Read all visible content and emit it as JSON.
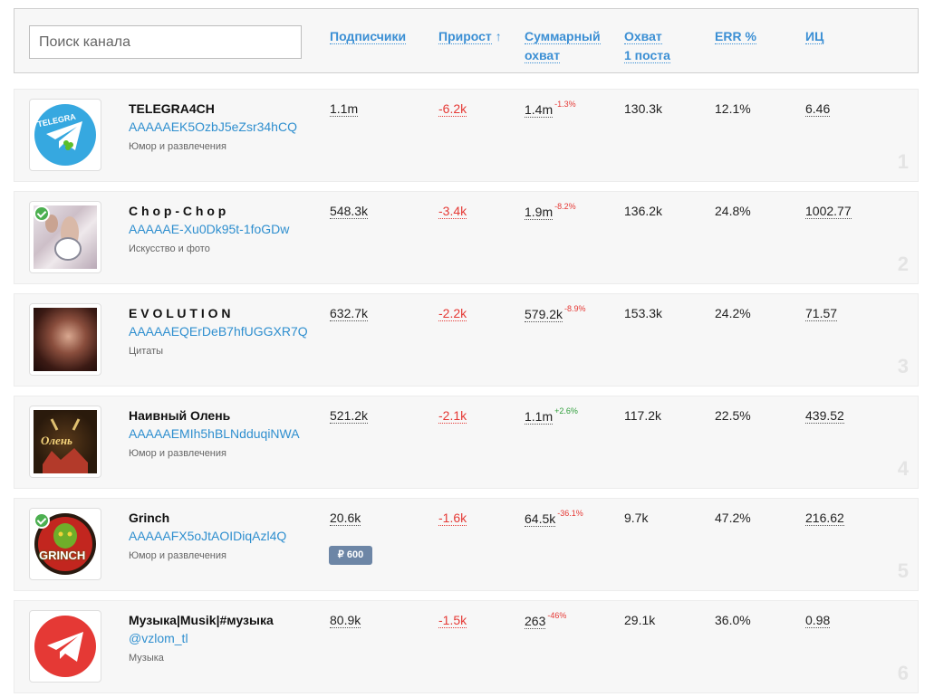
{
  "search": {
    "placeholder": "Поиск канала"
  },
  "columns": {
    "subscribers": "Подписчики",
    "growth": "Прирост",
    "growth_arrow": "↑",
    "reach_line1": "Суммарный",
    "reach_line2": "охват",
    "post_reach_line1": "Охват",
    "post_reach_line2": "1 поста",
    "err": "ERR %",
    "ic": "ИЦ"
  },
  "channels": [
    {
      "rank": "1",
      "name": "TELEGRA4CH",
      "link": "AAAAAEK5OzbJ5eZsr34hCQ",
      "category": "Юмор и развлечения",
      "subscribers": "1.1m",
      "growth": "-6.2k",
      "reach": "1.4m",
      "reach_change": "-1.3%",
      "post_reach": "130.3k",
      "err": "12.1%",
      "ic": "6.46",
      "verified": false,
      "avatar_text": "TELEGRA"
    },
    {
      "rank": "2",
      "name": "C h o p - C h o p",
      "link": "AAAAAE-Xu0Dk95t-1foGDw",
      "category": "Искусство и фото",
      "subscribers": "548.3k",
      "growth": "-3.4k",
      "reach": "1.9m",
      "reach_change": "-8.2%",
      "post_reach": "136.2k",
      "err": "24.8%",
      "ic": "1002.77",
      "verified": true
    },
    {
      "rank": "3",
      "name": "E V O L U T I O N",
      "link": "AAAAAEQErDeB7hfUGGXR7Q",
      "category": "Цитаты",
      "subscribers": "632.7k",
      "growth": "-2.2k",
      "reach": "579.2k",
      "reach_change": "-8.9%",
      "post_reach": "153.3k",
      "err": "24.2%",
      "ic": "71.57",
      "verified": false
    },
    {
      "rank": "4",
      "name": "Наивный Олень",
      "link": "AAAAAEMIh5hBLNdduqiNWA",
      "category": "Юмор и развлечения",
      "subscribers": "521.2k",
      "growth": "-2.1k",
      "reach": "1.1m",
      "reach_change": "+2.6%",
      "post_reach": "117.2k",
      "err": "22.5%",
      "ic": "439.52",
      "verified": false,
      "avatar_text": "Олень"
    },
    {
      "rank": "5",
      "name": "Grinch",
      "link": "AAAAAFX5oJtAOIDiqAzl4Q",
      "category": "Юмор и развлечения",
      "subscribers": "20.6k",
      "growth": "-1.6k",
      "reach": "64.5k",
      "reach_change": "-36.1%",
      "post_reach": "9.7k",
      "err": "47.2%",
      "ic": "216.62",
      "verified": true,
      "badge": "₽ 600",
      "avatar_text": "GRINCH"
    },
    {
      "rank": "6",
      "name": "Музыка|Musik|#музыка",
      "link": "@vzlom_tl",
      "category": "Музыка",
      "subscribers": "80.9k",
      "growth": "-1.5k",
      "reach": "263",
      "reach_change": "-46%",
      "post_reach": "29.1k",
      "err": "36.0%",
      "ic": "0.98",
      "verified": false
    }
  ],
  "colors": {
    "accent": "#3b8fd4",
    "negative": "#e53935",
    "positive": "#2e9e3a"
  }
}
